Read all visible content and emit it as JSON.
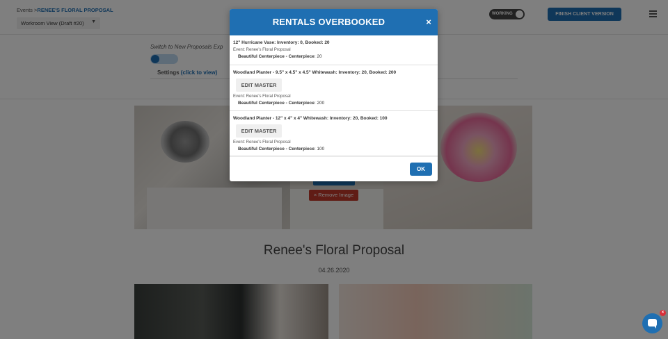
{
  "header": {
    "breadcrumb_prefix": "Events >",
    "breadcrumb_current": "RENEE'S FLORAL PROPOSAL",
    "view_select": "Workroom View (Draft #20)",
    "working_label": "WORKING",
    "finish_button": "FINISH CLIENT VERSION"
  },
  "subbar": {
    "switch_label": "Switch to New Proposals Exp",
    "settings_label": "Settings",
    "settings_link": "(click to view)"
  },
  "main": {
    "remove_image": "Remove Image",
    "proposal_title": "Renee's Floral Proposal",
    "proposal_date": "04.26.2020"
  },
  "modal": {
    "title": "RENTALS OVERBOOKED",
    "close_symbol": "×",
    "ok_label": "OK",
    "items": [
      {
        "title": "12\" Hurricane Vase: Inventory: 0, Booked: 20",
        "event": "Event: Renee's Floral Proposal",
        "line_bold": "Beautiful Centerpiece - Centerpiece",
        "line_rest": ": 20",
        "has_edit": false
      },
      {
        "title": "Woodland Planter - 9.5\" x 4.5\" x 4.5\" Whitewash: Inventory: 20, Booked: 200",
        "edit_label": "EDIT MASTER",
        "event": "Event: Renee's Floral Proposal",
        "line_bold": "Beautiful Centerpiece - Centerpiece",
        "line_rest": ": 200",
        "has_edit": true
      },
      {
        "title": "Woodland Planter - 12\" x 4\" x 4\" Whitewash: Inventory: 20, Booked: 100",
        "edit_label": "EDIT MASTER",
        "event": "Event: Renee's Floral Proposal",
        "line_bold": "Beautiful Centerpiece - Centerpiece",
        "line_rest": ": 100",
        "has_edit": true
      }
    ]
  },
  "chat": {
    "badge": "×"
  },
  "colors": {
    "accent": "#1f6fb2",
    "danger": "#c0392b"
  }
}
